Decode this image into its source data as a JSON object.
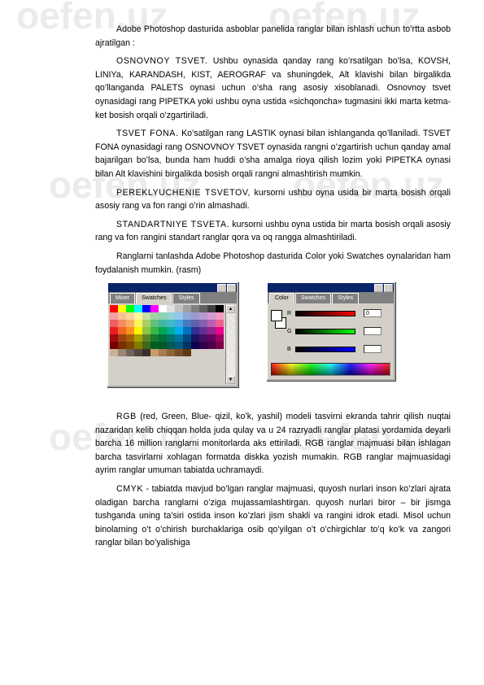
{
  "paragraphs": [
    {
      "lead": "",
      "text": "Adobe Photoshop dasturida asboblar panelida ranglar bilan ishlash uchun to’rtta asbob ajratilgan :"
    },
    {
      "lead": "OSNOVNOY TSVET.",
      "text": " Ushbu oynasida qanday rang ko’rsatilgan bo’lsa, KOVSH, LINIYa, KARANDASH, KIST, AEROGRAF va shuningdek, Alt klavishi bilan birgalikda qo’llanganda PALETS oynasi uchun o’sha rang asosiy xisoblanadi. Osnovnoy tsvet oynasidagi rang PIPETKA yoki ushbu oyna ustida «sichqoncha» tugmasini ikki marta ketma-ket bosish orqali o’zgartiriladi."
    },
    {
      "lead": "TSVET FONA.",
      "text": " Ko’satilgan rang LASTIK oynasi bilan ishlanganda qo’llaniladi. TSVET FONA oynasidagi rang OSNOVNOY TSVET oynasida rangni o’zgartirish uchun qanday amal bajarilgan bo’lsa, bunda ham huddi o’sha amalga rioya qilish lozim yoki PIPETKA oynasi bilan Alt  klavishini birgalikda bosish orqali  rangni almashtirish mumkin."
    },
    {
      "lead": "PEREKLYUCHENIE TSVETOV,",
      "text": " kursorni ushbu oyna usida bir marta bosish orqali asosiy rang va fon rangi o’rin almashadi."
    },
    {
      "lead": "STANDARTNIYE TSVETA.",
      "text": " kursorni ushbu oyna ustida bir marta bosish orqali asosiy rang va fon rangini standart ranglar qora va oq rangga almashtiriladi."
    },
    {
      "lead": "",
      "text": "Ranglarni tanlashda Adobe Photoshop dasturida Color   yoki Swatches oynalaridan ham foydalanish mumkin. (rasm)"
    }
  ],
  "swatches_window": {
    "tabs": [
      "Mixer",
      "Swatches",
      "Styles"
    ],
    "active_tab": 1,
    "rows": [
      [
        "#ff0000",
        "#ffff00",
        "#00ff00",
        "#00ffff",
        "#0000ff",
        "#ff00ff",
        "#ffffff",
        "#e0e0e0",
        "#c0c0c0",
        "#a0a0a0",
        "#808080",
        "#606060",
        "#404040",
        "#000000"
      ],
      [
        "#f4a0a0",
        "#f9c09a",
        "#fbd49a",
        "#fff59a",
        "#c5e0a0",
        "#a0d4a0",
        "#8fd3b0",
        "#8fd3d8",
        "#8fc8ee",
        "#90a8d8",
        "#9a9ad0",
        "#b49ad0",
        "#d49ad0",
        "#f49ac0"
      ],
      [
        "#f06060",
        "#f48a60",
        "#f8b060",
        "#fff060",
        "#a8d060",
        "#60c080",
        "#40b8a0",
        "#40b8c8",
        "#40a8e0",
        "#4878c0",
        "#6060b0",
        "#8860b0",
        "#b860b0",
        "#f06090"
      ],
      [
        "#ed1c24",
        "#f26522",
        "#f7941d",
        "#fff200",
        "#8dc63f",
        "#39b54a",
        "#00a651",
        "#00a99d",
        "#00aeef",
        "#0072bc",
        "#2e3192",
        "#662d91",
        "#92278f",
        "#ec008c"
      ],
      [
        "#9e0b0f",
        "#a0410d",
        "#a3620a",
        "#aba000",
        "#598527",
        "#197b30",
        "#007236",
        "#00746b",
        "#0076a3",
        "#004a80",
        "#1b1464",
        "#440e62",
        "#630460",
        "#9e005d"
      ],
      [
        "#790000",
        "#7b2e00",
        "#7d4900",
        "#827b00",
        "#406618",
        "#005e20",
        "#005826",
        "#005952",
        "#005b7f",
        "#003663",
        "#0d004c",
        "#32004b",
        "#4b0049",
        "#7b0046"
      ],
      [
        "#c7b299",
        "#998675",
        "#736357",
        "#534741",
        "#37302d",
        "#c69c6d",
        "#a67c52",
        "#8c6239",
        "#754c24",
        "#603913",
        "#d4d0c8",
        "#d4d0c8",
        "#d4d0c8",
        "#d4d0c8"
      ]
    ]
  },
  "color_window": {
    "tabs": [
      "Color",
      "Swatches",
      "Styles"
    ],
    "active_tab": 0,
    "sliders": [
      {
        "label": "R",
        "value": "0",
        "color": "#ff0000"
      },
      {
        "label": "G",
        "value": "",
        "color": "#00ff00"
      },
      {
        "label": "B",
        "value": "",
        "color": "#0000ff"
      }
    ]
  },
  "paragraphs2": [
    {
      "lead": "RGB",
      "text": " (red, Green, Blue- qizil, ko’k, yashil) modeli tasvirni ekranda tahrir qilish nuqtai nazaridan kelib chiqqan holda juda qulay va u 24 razryadli ranglar platasi yordamida deyarli   barcha 16 million ranglarni monitorlarda aks ettiriladi. RGB  ranglar majmuasi bilan ishlagan barcha tasvirlarni xohlagan formatda diskka yozish mumakin. RGB   ranglar majmuasidagi ayrim ranglar umuman tabiatda uchramaydi."
    },
    {
      "lead": "CMYK",
      "text": " - tabiatda mavjud bo’lgan ranglar majmuasi, quyosh nurlari inson ko’zlari ajrata oladigan barcha ranglarni o’ziga mujassamlashtirgan. quyosh nurlari biror – bir  jismga tushganda uning ta’siri  ostida inson ko’zlari jism shakli va rangini idrok etadi. Misol uchun binolarning o’t o’chirish burchaklariga osib qo’yilgan  o’t o’chirgichlar to’q ko’k va zangori ranglar bilan bo’yalishiga"
    }
  ],
  "watermark": "oefen.uz"
}
